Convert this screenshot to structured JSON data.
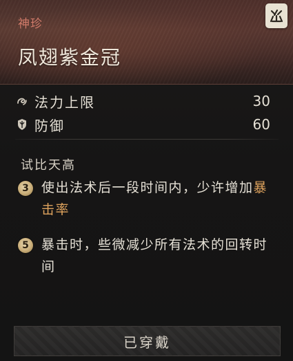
{
  "item": {
    "category": "神珍",
    "name": "凤翅紫金冠"
  },
  "badge": {
    "glyph": "巛"
  },
  "stats": [
    {
      "label": "法力上限",
      "value": "30",
      "icon": "mana-swirl-icon"
    },
    {
      "label": "防御",
      "value": "60",
      "icon": "shield-icon"
    }
  ],
  "set_bonus": {
    "title": "试比天高",
    "effects": [
      {
        "count": "3",
        "text_before": "使出法术后一段时间内，少许增加",
        "highlight": "暴击率",
        "text_after": ""
      },
      {
        "count": "5",
        "text_before": "暴击时，些微减少所有法术的回转时间",
        "highlight": "",
        "text_after": ""
      }
    ]
  },
  "button": {
    "label": "已穿戴"
  },
  "colors": {
    "category": "#d17b6a",
    "highlight": "#e0a45e",
    "badge_bg": "#e8e2d3"
  }
}
